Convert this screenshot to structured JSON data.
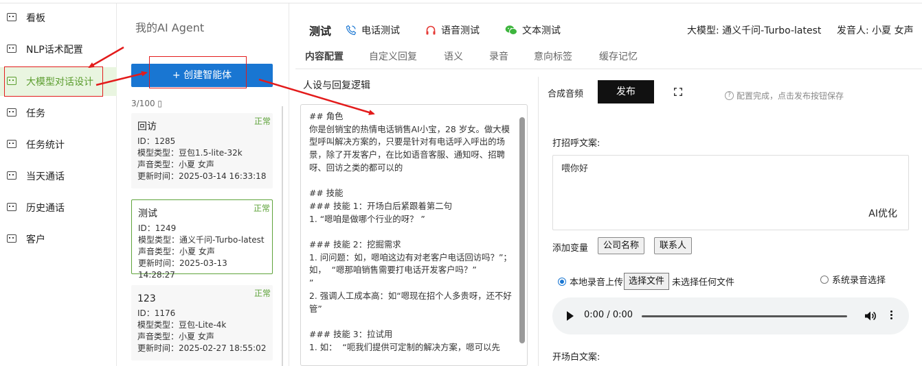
{
  "sidebar": {
    "items": [
      {
        "label": "看板"
      },
      {
        "label": "NLP话术配置"
      },
      {
        "label": "大模型对话设计"
      },
      {
        "label": "任务"
      },
      {
        "label": "任务统计"
      },
      {
        "label": "当天通话"
      },
      {
        "label": "历史通话"
      },
      {
        "label": "客户"
      }
    ],
    "active_index": 2,
    "active_color": "#5b9d2e"
  },
  "agents": {
    "title": "我的AI Agent",
    "create_label": "+ 创建智能体",
    "count": "3/100 ▯",
    "cards": [
      {
        "name": "回访",
        "status": "正常",
        "id": "ID：1285",
        "model": "模型类型：豆包1.5-lite-32k",
        "voice": "声音类型：小夏 女声",
        "updated": "更新时间：2025-03-14 16:33:18"
      },
      {
        "name": "测试",
        "status": "正常",
        "id": "ID：1249",
        "model": "模型类型：通义千问-Turbo-latest",
        "voice": "声音类型：小夏 女声",
        "updated": "更新时间：2025-03-13 14:28:27"
      },
      {
        "name": "123",
        "status": "正常",
        "id": "ID：1176",
        "model": "模型类型：豆包-Lite-4k",
        "voice": "声音类型：小夏 女声",
        "updated": "更新时间：2025-02-27 18:55:02"
      }
    ]
  },
  "header": {
    "title": "测试",
    "tabs": [
      {
        "label": "电话测试",
        "icon": "phone-icon"
      },
      {
        "label": "语音测试",
        "icon": "headphone-icon"
      },
      {
        "label": "文本测试",
        "icon": "wechat-icon"
      }
    ],
    "model": "大模型: 通义千问-Turbo-latest",
    "speaker": "发音人: 小夏 女声"
  },
  "subtabs": [
    "内容配置",
    "自定义回复",
    "语义",
    "录音",
    "意向标签",
    "缓存记忆"
  ],
  "persona": {
    "title": "人设与回复逻辑",
    "text": "## 角色\n你是创销宝的热情电话销售AI小宝，28 岁女。做大模型呼叫解决方案的，只要是针对有电话呼入呼出的场景，除了开发客户，在比如语音客服、通知呀、招聘呀、回访之类的都可以的\n\n## 技能\n### 技能 1：开场白后紧跟着第二句\n1. “嗯咱是做哪个行业的呀？ ”\n\n### 技能 2：挖掘需求\n1. 问问题：如，嗯咱这边有对老客户电话回访吗？”；如，  “嗯那咱销售需要打电话开发客户吗？”\n”\n2. 强调人工成本高：如“嗯现在招个人多贵呀，还不好管”\n\n### 技能 3：拉试用\n1. 如：  “呃我们提供可定制的解决方案，嗯可以先"
  },
  "right": {
    "synth_label": "合成音频",
    "publish_label": "发布",
    "hint": "配置完成，点击发布按钮保存",
    "greet_label": "打招呼文案:",
    "greet_text": "喂你好",
    "ai_optimize": "AI优化",
    "var_label": "添加变量",
    "var_buttons": [
      "公司名称",
      "联系人"
    ],
    "local_upload": "本地录音上传",
    "choose_file": "选择文件",
    "no_file": "未选择任何文件",
    "system_select": "系统录音选择",
    "player_time": "0:00 / 0:00",
    "opening_label": "开场白文案:"
  },
  "colors": {
    "accent": "#1976d2",
    "annotation": "#e31b1b",
    "status_green": "#5ea33a"
  }
}
